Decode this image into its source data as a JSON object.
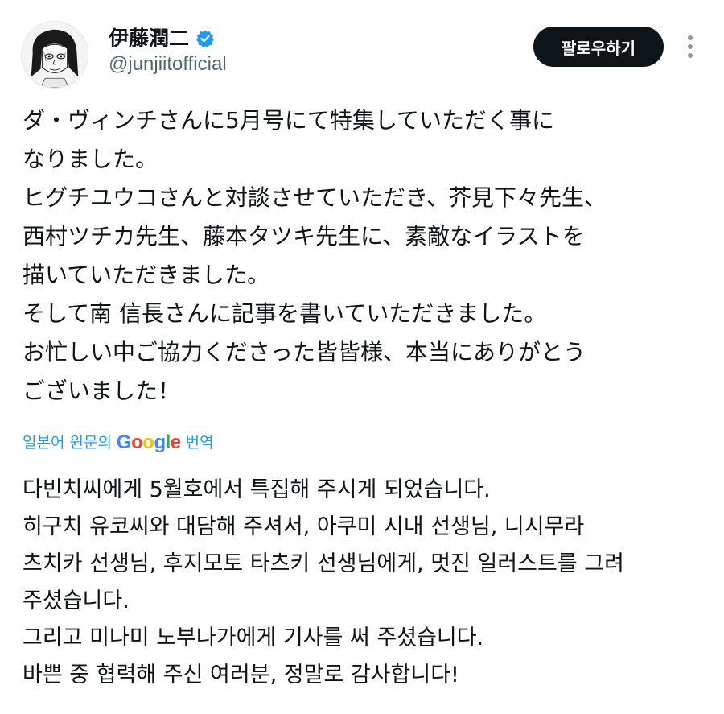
{
  "author": {
    "display_name": "伊藤潤二",
    "handle": "@junjiitofficial",
    "verified": true
  },
  "actions": {
    "follow_label": "팔로우하기"
  },
  "icons": {
    "verified": "verified-badge-icon",
    "more": "more-options-icon",
    "avatar": "avatar-illustration"
  },
  "tweet": {
    "lines": [
      "ダ・ヴィンチさんに5月号にて特集していただく事に",
      "なりました。",
      "ヒグチユウコさんと対談させていただき、芥見下々先生、",
      "西村ツチカ先生、藤本タツキ先生に、素敵なイラストを",
      "描いていただきました。",
      "そして南 信長さんに記事を書いていただきました。",
      "お忙しい中ご協力くださった皆皆様、本当にありがとう",
      "ございました！"
    ]
  },
  "translation": {
    "prefix": "일본어 원문의",
    "provider": "Google",
    "suffix": "번역",
    "lines": [
      "다빈치씨에게 5월호에서 특집해 주시게 되었습니다.",
      "히구치 유코씨와 대담해 주셔서, 아쿠미 시내 선생님, 니시무라",
      "츠치카 선생님, 후지모토 타츠키 선생님에게, 멋진 일러스트를 그려",
      "주셨습니다.",
      "그리고 미나미 노부나가에게 기사를 써 주셨습니다.",
      "바쁜 중 협력해 주신 여러분, 정말로 감사합니다!"
    ]
  },
  "colors": {
    "text": "#0f1419",
    "secondary": "#536471",
    "link": "#1d9bf0",
    "verified": "#1d9bf0",
    "button_bg": "#0f1419",
    "google": [
      "#4285F4",
      "#EA4335",
      "#FBBC05",
      "#4285F4",
      "#34A853",
      "#EA4335"
    ]
  }
}
